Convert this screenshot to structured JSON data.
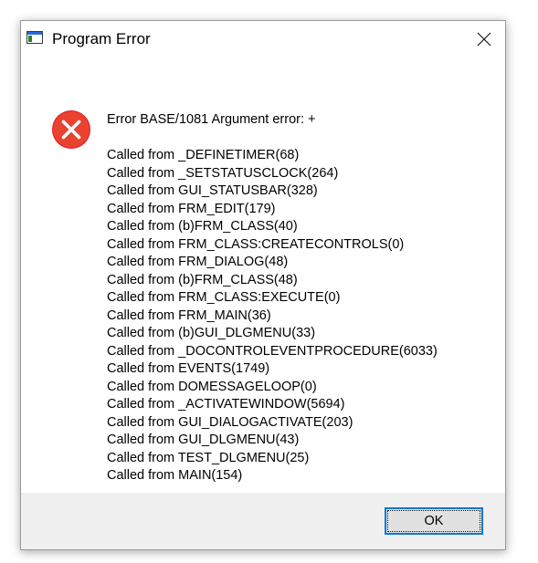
{
  "window": {
    "title": "Program Error",
    "app_icon": "program-window-icon",
    "close_icon": "close-icon"
  },
  "error": {
    "icon": "error-icon",
    "icon_color": "#e81123",
    "headline": "Error BASE/1081  Argument error: +",
    "call_stack": [
      "Called from _DEFINETIMER(68)",
      "Called from _SETSTATUSCLOCK(264)",
      "Called from GUI_STATUSBAR(328)",
      "Called from FRM_EDIT(179)",
      "Called from (b)FRM_CLASS(40)",
      "Called from FRM_CLASS:CREATECONTROLS(0)",
      "Called from FRM_DIALOG(48)",
      "Called from (b)FRM_CLASS(48)",
      "Called from FRM_CLASS:EXECUTE(0)",
      "Called from FRM_MAIN(36)",
      "Called from (b)GUI_DLGMENU(33)",
      "Called from _DOCONTROLEVENTPROCEDURE(6033)",
      "Called from EVENTS(1749)",
      "Called from DOMESSAGELOOP(0)",
      "Called from _ACTIVATEWINDOW(5694)",
      "Called from GUI_DIALOGACTIVATE(203)",
      "Called from GUI_DLGMENU(43)",
      "Called from TEST_DLGMENU(25)",
      "Called from MAIN(154)"
    ]
  },
  "footer": {
    "ok_label": "OK",
    "focus_color": "#0078d7"
  }
}
